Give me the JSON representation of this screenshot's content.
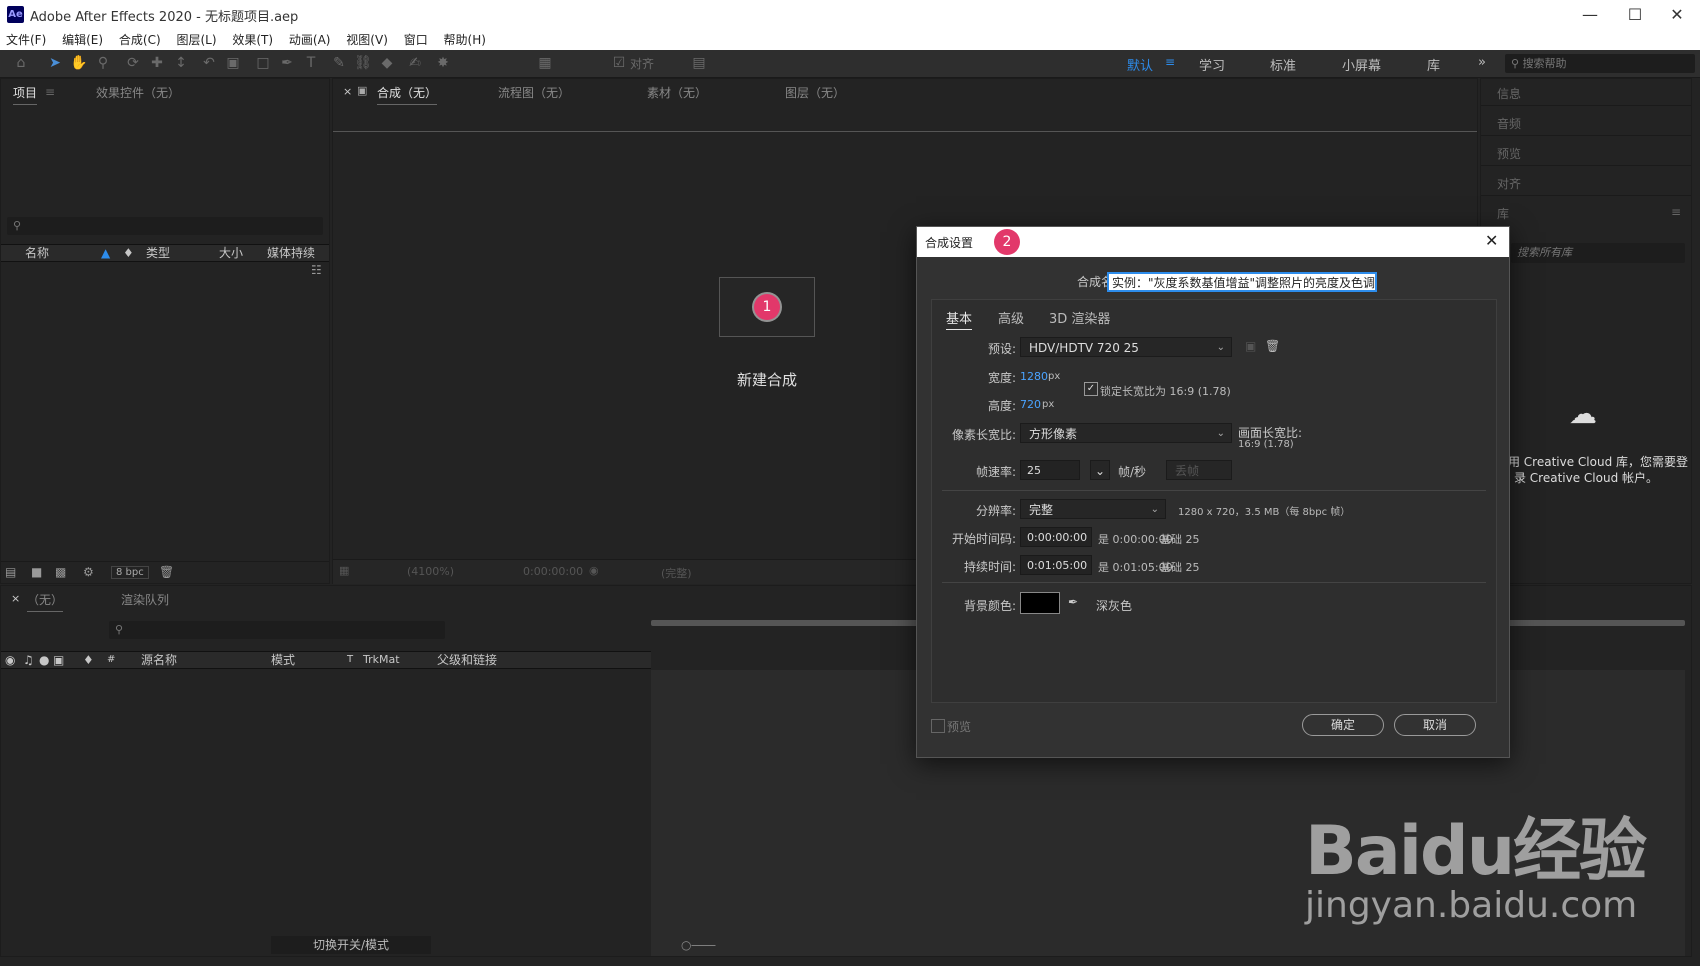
{
  "window": {
    "title": "Adobe After Effects 2020 - 无标题项目.aep",
    "logo": "Ae"
  },
  "menu": [
    "文件(F)",
    "编辑(E)",
    "合成(C)",
    "图层(L)",
    "效果(T)",
    "动画(A)",
    "视图(V)",
    "窗口",
    "帮助(H)"
  ],
  "toolbar": {
    "snap_label": "对齐"
  },
  "workspaces": [
    "默认",
    "学习",
    "标准",
    "小屏幕",
    "库"
  ],
  "help_search_placeholder": "搜索帮助",
  "project_panel": {
    "tabs": [
      "项目",
      "效果控件（无）"
    ],
    "columns": [
      "名称",
      "类型",
      "大小",
      "媒体持续"
    ],
    "bpc": "8 bpc"
  },
  "comp_panel": {
    "tabs": [
      "合成（无）",
      "流程图（无）",
      "素材（无）",
      "图层（无）"
    ],
    "new_comp_label": "新建合成",
    "zoom": "(4100%)",
    "timecode": "0:00:00:00",
    "quality": "(完整)"
  },
  "right_panel": {
    "items": [
      "信息",
      "音频",
      "预览",
      "对齐",
      "库"
    ],
    "library_search_placeholder": "搜索所有库",
    "cc_message_line1": "要使用 Creative Cloud 库，您需要登",
    "cc_message_line2": "录 Creative Cloud 帐户。"
  },
  "timeline": {
    "tabs": [
      "（无）",
      "渲染队列"
    ],
    "columns": [
      "#",
      "源名称",
      "模式",
      "T",
      "TrkMat",
      "父级和链接"
    ],
    "toggle_label": "切换开关/模式"
  },
  "dialog": {
    "title": "合成设置",
    "comp_name_label": "合成名称:",
    "comp_name_value": "实例：\"灰度系数基值增益\"调整照片的亮度及色调",
    "tabs": [
      "基本",
      "高级",
      "3D 渲染器"
    ],
    "preset_label": "预设:",
    "preset_value": "HDV/HDTV 720 25",
    "width_label": "宽度:",
    "width_value": "1280",
    "height_label": "高度:",
    "height_value": "720",
    "unit_px": "px",
    "lock_aspect_label": "锁定长宽比为 16:9 (1.78)",
    "pixel_aspect_label": "像素长宽比:",
    "pixel_aspect_value": "方形像素",
    "frame_aspect_label": "画面长宽比:",
    "frame_aspect_value": "16:9 (1.78)",
    "frame_rate_label": "帧速率:",
    "frame_rate_value": "25",
    "fps_unit": "帧/秒",
    "drop_frame": "丢帧",
    "resolution_label": "分辨率:",
    "resolution_value": "完整",
    "resolution_info": "1280 x 720，3.5 MB（每 8bpc 帧）",
    "start_tc_label": "开始时间码:",
    "start_tc_value": "0:00:00:00",
    "start_tc_note": "是 0:00:00:00",
    "start_tc_base": "基础 25",
    "duration_label": "持续时间:",
    "duration_value": "0:01:05:00",
    "duration_note": "是 0:01:05:00",
    "duration_base": "基础 25",
    "bg_color_label": "背景颜色:",
    "bg_color_name": "深灰色",
    "preview_label": "预览",
    "ok_label": "确定",
    "cancel_label": "取消"
  },
  "badges": [
    "1",
    "2"
  ],
  "watermark": {
    "brand": "Baidu经验",
    "url": "jingyan.baidu.com"
  },
  "colors": {
    "accent": "#2d8ceb",
    "badge": "#e2386a",
    "panel": "#232323",
    "dialog": "#323232"
  }
}
